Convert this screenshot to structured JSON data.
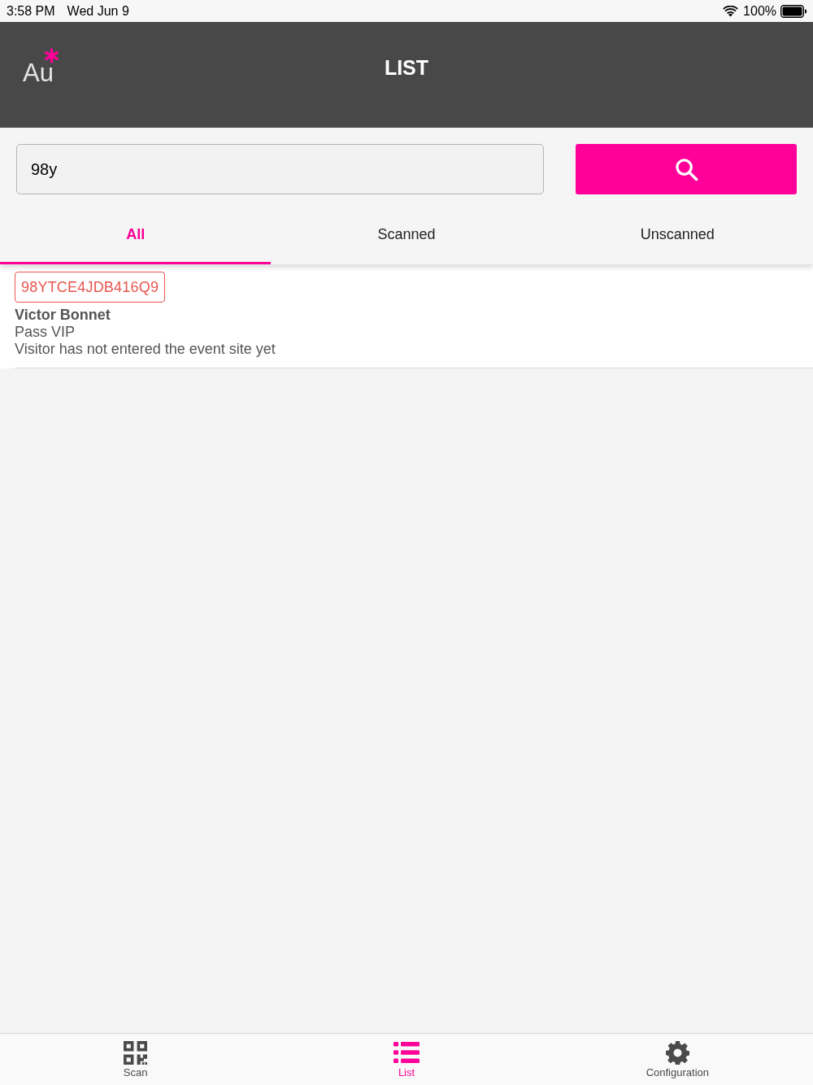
{
  "status_bar": {
    "time": "3:58 PM",
    "date": "Wed Jun 9",
    "battery": "100%"
  },
  "header": {
    "logo": "Au",
    "title": "LIST"
  },
  "search": {
    "value": "98y"
  },
  "tabs": [
    {
      "label": "All",
      "selected": true
    },
    {
      "label": "Scanned",
      "selected": false
    },
    {
      "label": "Unscanned",
      "selected": false
    }
  ],
  "visitors": [
    {
      "code": "98YTCE4JDB416Q9",
      "color": "#e8554f",
      "name": "Victor Bonnet",
      "pass": "Pass VIP",
      "status": "Visitor has not entered the event site yet"
    }
  ],
  "bottom_nav": [
    {
      "kind": "scan",
      "label": "Scan",
      "selected": false
    },
    {
      "kind": "list",
      "label": "List",
      "selected": true
    },
    {
      "kind": "config",
      "label": "Configuration",
      "selected": false
    }
  ]
}
